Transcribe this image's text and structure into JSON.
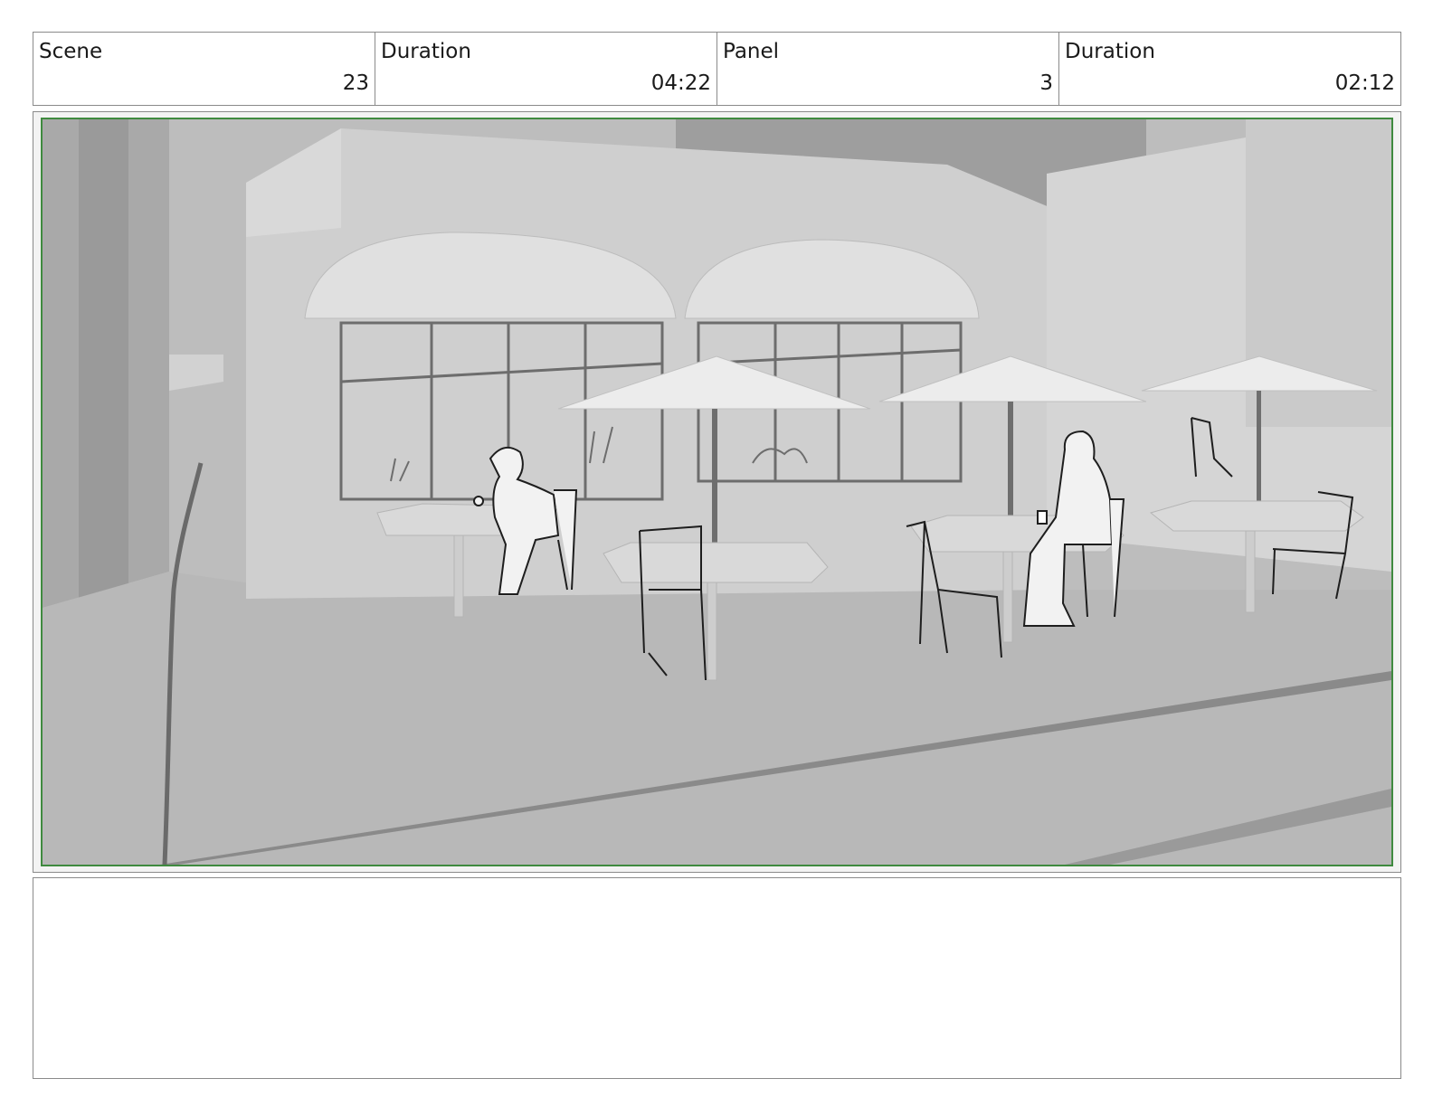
{
  "header": {
    "scene": {
      "label": "Scene",
      "value": "23"
    },
    "scene_duration": {
      "label": "Duration",
      "value": "04:22"
    },
    "panel": {
      "label": "Panel",
      "value": "3"
    },
    "panel_duration": {
      "label": "Duration",
      "value": "02:12"
    }
  },
  "panel_image": {
    "description_icons": [
      "cafe-building",
      "awning",
      "patio-umbrella",
      "cafe-table",
      "chair",
      "seated-woman",
      "seated-man",
      "sidewalk"
    ]
  },
  "notes": {
    "action": ""
  }
}
